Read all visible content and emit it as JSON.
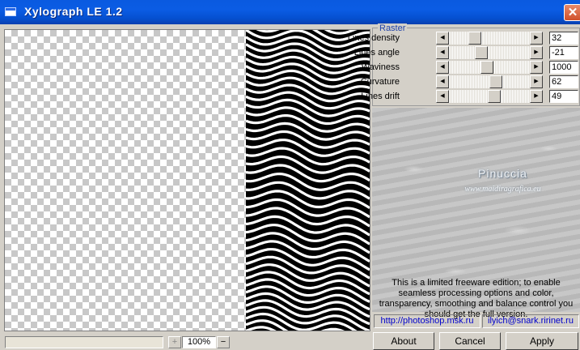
{
  "window": {
    "title": "Xylograph LE 1.2",
    "close_glyph": "✕"
  },
  "raster": {
    "group_label": "Raster",
    "params": [
      {
        "label": "Lines density",
        "value": "32",
        "slider_fraction": 0.28
      },
      {
        "label": "Lines angle",
        "value": "-21",
        "slider_fraction": 0.38
      },
      {
        "label": "Waviness",
        "value": "1000",
        "slider_fraction": 0.46
      },
      {
        "label": "Curvature",
        "value": "62",
        "slider_fraction": 0.6
      },
      {
        "label": "Lines drift",
        "value": "49",
        "slider_fraction": 0.57
      }
    ]
  },
  "watermark": {
    "name": "Pinuccia",
    "site": "www.maidiragrafica.eu"
  },
  "notice": "This is a limited freeware edition; to enable seamless processing options and color, transparency, smoothing and balance control you should get the full version.",
  "links": {
    "site": "http://photoshop.msk.ru",
    "email": "ilyich@snark.ririnet.ru"
  },
  "buttons": {
    "about": "About",
    "cancel": "Cancel",
    "apply": "Apply"
  },
  "zoom": {
    "plus": "+",
    "value": "100%",
    "minus": "−"
  },
  "icons": {
    "arrow_left": "◀",
    "arrow_right": "▶"
  }
}
